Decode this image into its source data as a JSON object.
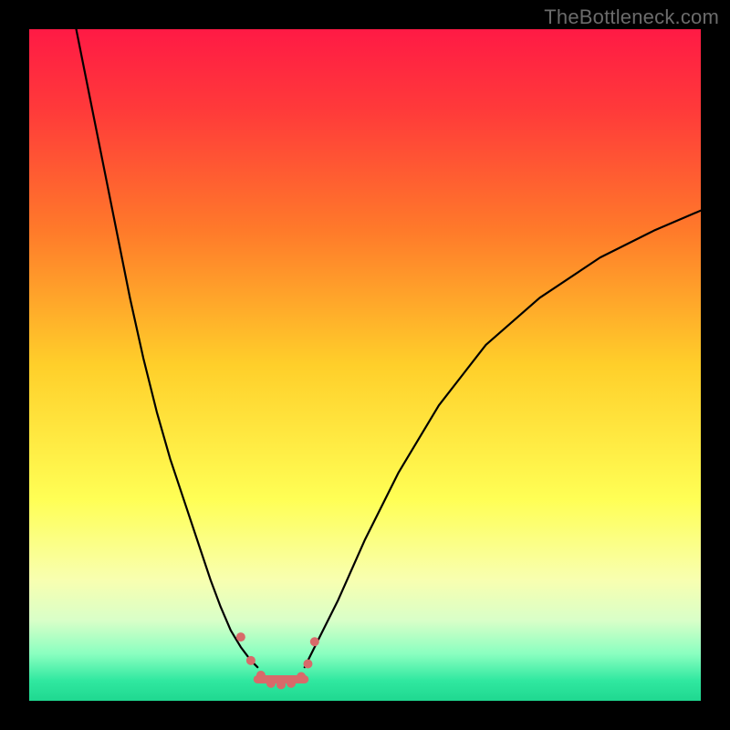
{
  "watermark": "TheBottleneck.com",
  "chart_data": {
    "type": "line",
    "title": "",
    "xlabel": "",
    "ylabel": "",
    "xlim": [
      0,
      100
    ],
    "ylim": [
      0,
      100
    ],
    "gradient_stops": [
      {
        "pct": 0,
        "color": "#ff1a45"
      },
      {
        "pct": 12,
        "color": "#ff3a3a"
      },
      {
        "pct": 30,
        "color": "#ff7a2a"
      },
      {
        "pct": 50,
        "color": "#ffcf2a"
      },
      {
        "pct": 70,
        "color": "#ffff55"
      },
      {
        "pct": 82,
        "color": "#f8ffb0"
      },
      {
        "pct": 88,
        "color": "#d9ffc8"
      },
      {
        "pct": 93,
        "color": "#8affc0"
      },
      {
        "pct": 97,
        "color": "#30e8a0"
      },
      {
        "pct": 100,
        "color": "#1fd890"
      }
    ],
    "series": [
      {
        "name": "curve-left",
        "color": "#000000",
        "width": 2.2,
        "x": [
          7,
          9,
          11,
          13,
          15,
          17,
          19,
          21,
          23,
          25,
          27,
          28.5,
          30,
          31.5,
          33,
          34
        ],
        "y": [
          100,
          90,
          80,
          70,
          60,
          51,
          43,
          36,
          30,
          24,
          18,
          14,
          10.5,
          8,
          6,
          5
        ]
      },
      {
        "name": "curve-right",
        "color": "#000000",
        "width": 2.2,
        "x": [
          41,
          43,
          46,
          50,
          55,
          61,
          68,
          76,
          85,
          93,
          100
        ],
        "y": [
          5,
          9,
          15,
          24,
          34,
          44,
          53,
          60,
          66,
          70,
          73
        ]
      },
      {
        "name": "bottom-marks",
        "type": "scatter",
        "color": "#d86a6a",
        "radius": 5,
        "x": [
          31.5,
          33,
          34.5,
          36,
          37.5,
          39,
          40.5,
          41.5,
          42.5
        ],
        "y": [
          9.5,
          6,
          3.8,
          2.6,
          2.4,
          2.6,
          3.6,
          5.5,
          8.8
        ]
      },
      {
        "name": "bottom-floor",
        "type": "line",
        "color": "#d86a6a",
        "width": 9,
        "x": [
          34,
          41
        ],
        "y": [
          3.2,
          3.2
        ]
      }
    ]
  }
}
